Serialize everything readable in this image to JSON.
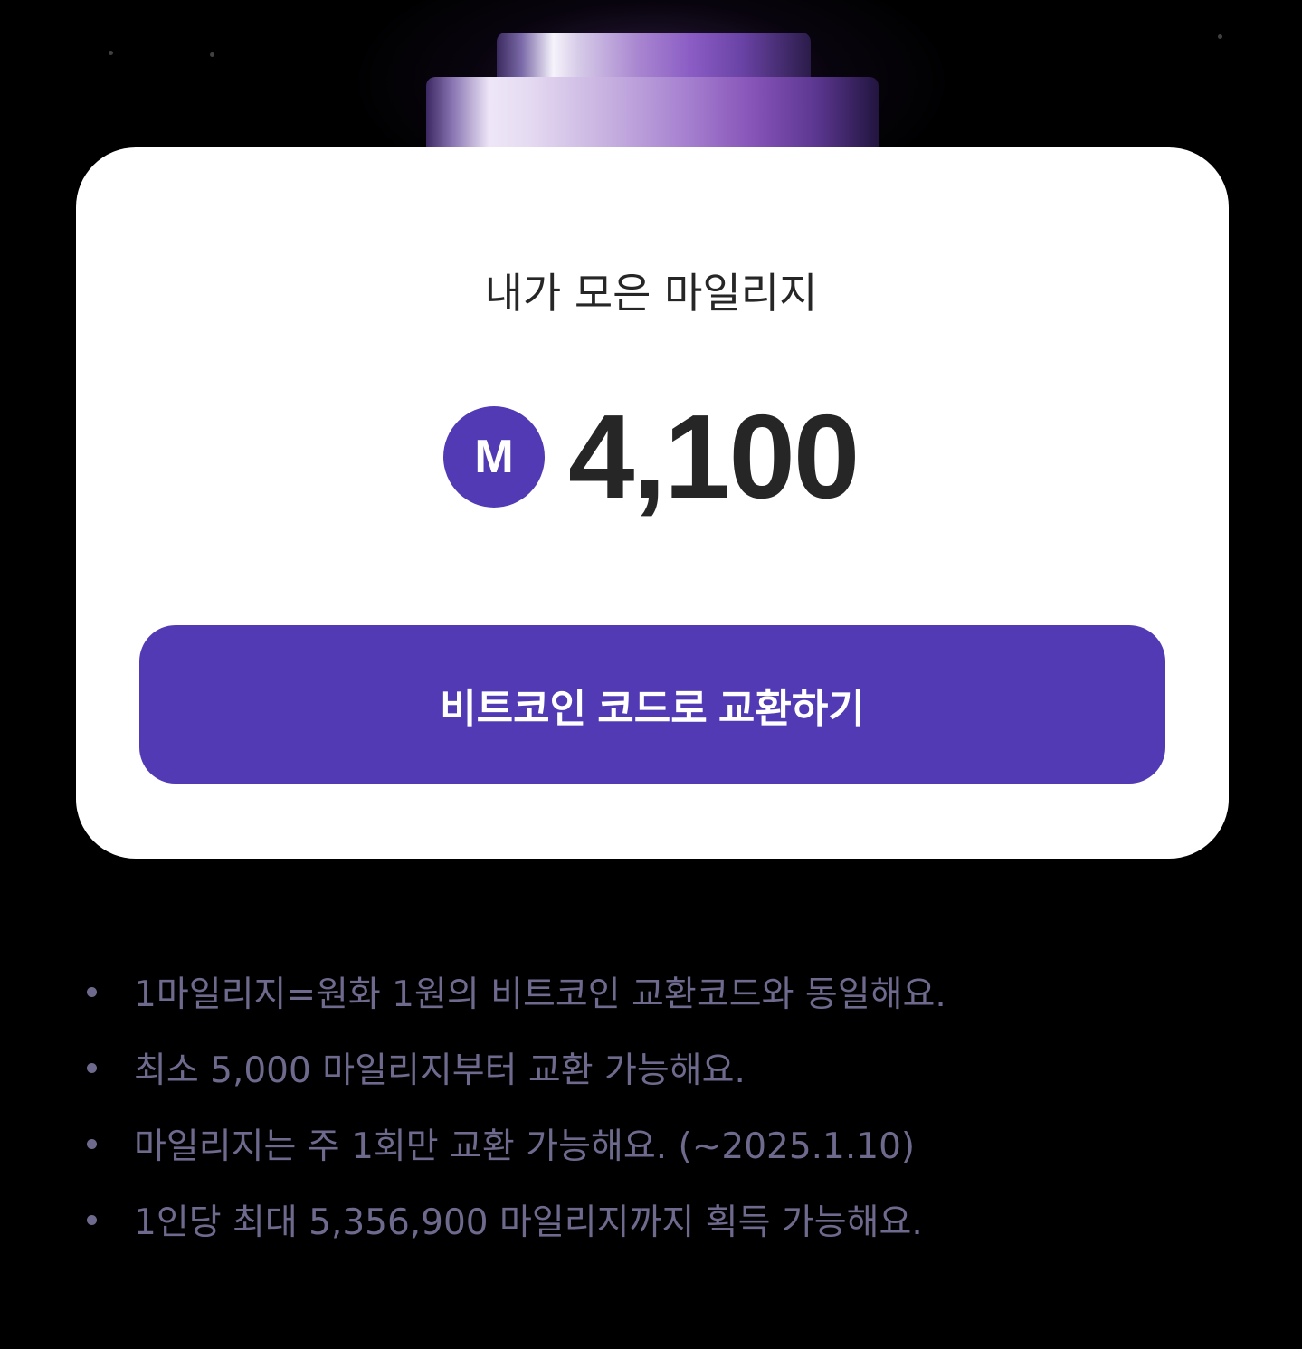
{
  "mileage": {
    "title": "내가 모은 마일리지",
    "currency_badge": "M",
    "balance": "4,100",
    "exchange_button_label": "비트코인 코드로 교환하기"
  },
  "notes": [
    "1마일리지=원화 1원의 비트코인 교환코드와 동일해요.",
    "최소 5,000 마일리지부터 교환 가능해요.",
    "마일리지는 주 1회만 교환 가능해요. (~2025.1.10)",
    "1인당 최대 5,356,900 마일리지까지 획득 가능해요."
  ],
  "colors": {
    "background": "#000000",
    "card": "#ffffff",
    "accent": "#523ab5",
    "note_text": "#6e6a8e"
  }
}
